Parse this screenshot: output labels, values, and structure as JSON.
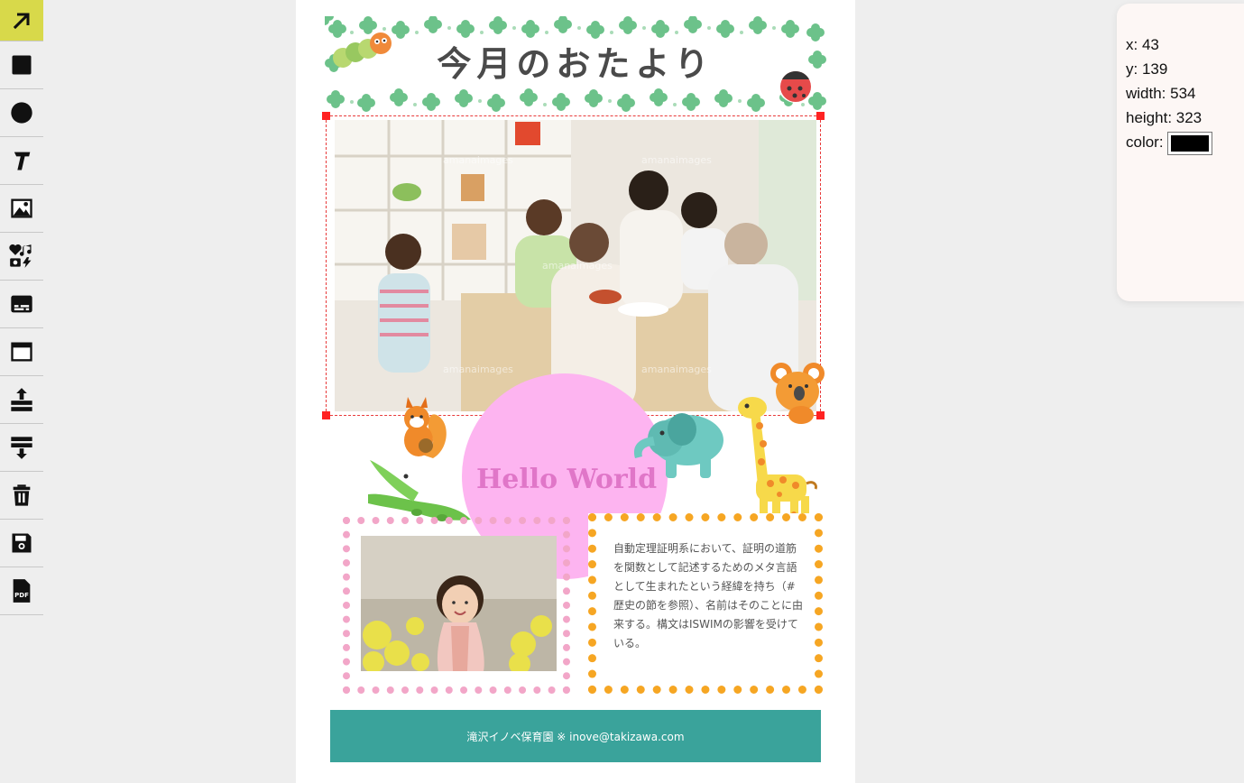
{
  "toolbar": {
    "tools": [
      {
        "name": "arrow-tool",
        "icon": "arrow-up-right-icon",
        "active": true
      },
      {
        "name": "rectangle-tool",
        "icon": "square-icon"
      },
      {
        "name": "circle-tool",
        "icon": "circle-icon"
      },
      {
        "name": "text-tool",
        "icon": "text-t-icon"
      },
      {
        "name": "image-tool",
        "icon": "image-icon"
      },
      {
        "name": "stickers-tool",
        "icon": "stickers-icon"
      },
      {
        "name": "subtitle-tool",
        "icon": "subtitles-icon"
      },
      {
        "name": "frame-tool",
        "icon": "window-icon"
      },
      {
        "name": "bring-forward-tool",
        "icon": "bring-forward-icon"
      },
      {
        "name": "send-backward-tool",
        "icon": "send-backward-icon"
      },
      {
        "name": "delete-tool",
        "icon": "trash-icon"
      },
      {
        "name": "save-tool",
        "icon": "save-icon"
      },
      {
        "name": "pdf-tool",
        "icon": "pdf-icon",
        "label": "PDF"
      }
    ],
    "accent": "#d8d94a"
  },
  "document": {
    "title": "今月のおたより",
    "headline": "Hello World",
    "body": "自動定理証明系において、証明の道筋を関数として記述するためのメタ言語として生まれたという経緯を持ち（#歴史の節を参照）、名前はそのことに由来する。構文はISWIMの影響を受けている。",
    "footer": "滝沢イノベ保育園 ※ inove@takizawa.com",
    "watermark": "amanaimages",
    "colors": {
      "footer_bg": "#3aa39b",
      "circle": "#fdb4f0",
      "headline": "#e076c8",
      "pink_frame": "#f2a6c8",
      "orange_frame": "#f6a623",
      "clover": "#6cc28a"
    }
  },
  "properties": {
    "x_label": "x: 43",
    "y_label": "y: 139",
    "width_label": "width: 534",
    "height_label": "height: 323",
    "color_label": "color:",
    "color_value": "#000000"
  }
}
